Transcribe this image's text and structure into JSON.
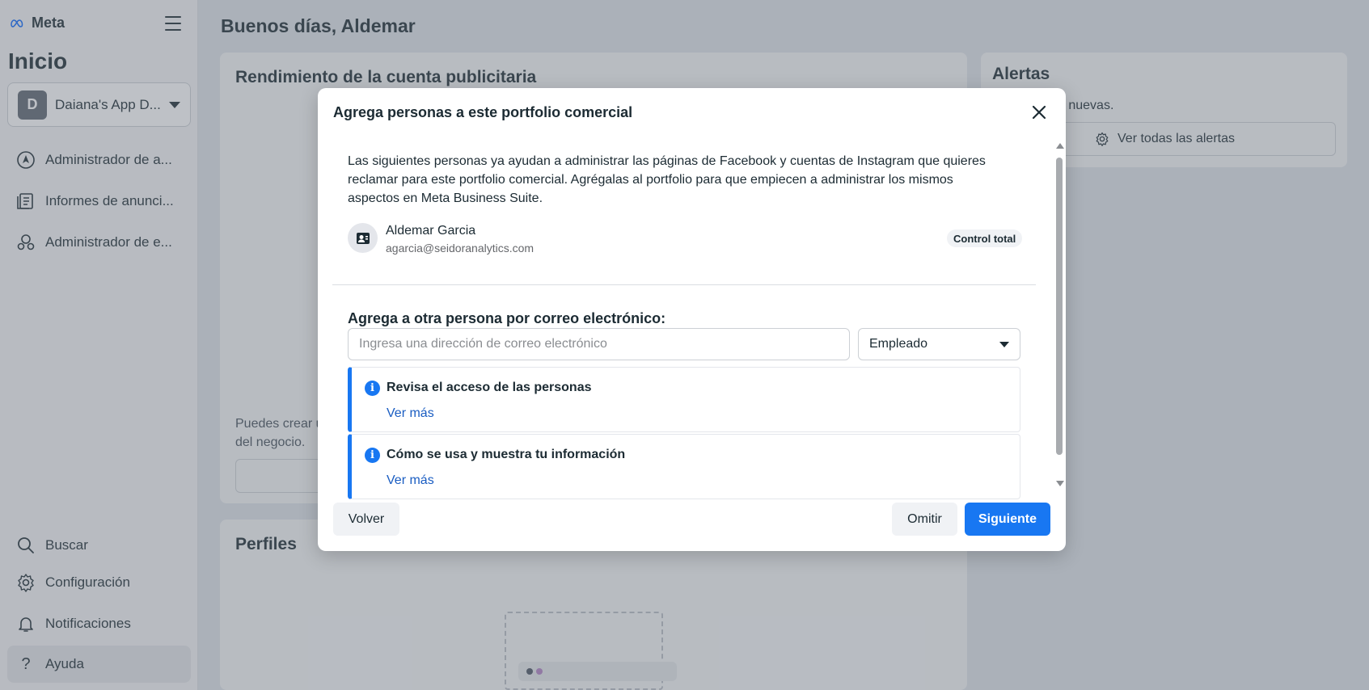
{
  "brand": {
    "name": "Meta"
  },
  "sidebar": {
    "title": "Inicio",
    "account": {
      "initial": "D",
      "name": "Daiana's App D..."
    },
    "nav_items": [
      {
        "label": "Administrador de a...",
        "icon": "navigation-icon"
      },
      {
        "label": "Informes de anunci...",
        "icon": "reports-icon"
      },
      {
        "label": "Administrador de e...",
        "icon": "events-icon"
      }
    ],
    "bottom_items": [
      {
        "label": "Buscar",
        "icon": "search-icon"
      },
      {
        "label": "Configuración",
        "icon": "gear-icon"
      },
      {
        "label": "Notificaciones",
        "icon": "bell-icon"
      },
      {
        "label": "Ayuda",
        "icon": "help-icon"
      }
    ]
  },
  "main": {
    "greeting": "Buenos días, Aldemar",
    "performance_card": {
      "title": "Rendimiento de la cuenta publicitaria",
      "text_line1": "Puedes crear u",
      "text_line2": "del negocio."
    },
    "profiles_card": {
      "title": "Perfiles"
    },
    "alerts_card": {
      "title": "Alertas",
      "text": "as nuevas.",
      "button_label": "Ver todas las alertas"
    }
  },
  "modal": {
    "title": "Agrega personas a este portfolio comercial",
    "intro": "Las siguientes personas ya ayudan a administrar las páginas de Facebook y cuentas de Instagram que quieres reclamar para este portfolio comercial. Agrégalas al portfolio para que empiecen a administrar los mismos aspectos en Meta Business Suite.",
    "person": {
      "name": "Aldemar Garcia",
      "email": "agarcia@seidoranalytics.com",
      "badge": "Control total"
    },
    "add_label": "Agrega a otra persona por correo electrónico:",
    "email_placeholder": "Ingresa una dirección de correo electrónico",
    "email_value": "",
    "role_selected": "Empleado",
    "info_boxes": [
      {
        "title": "Revisa el acceso de las personas",
        "link": "Ver más"
      },
      {
        "title": "Cómo se usa y muestra tu información",
        "link": "Ver más"
      }
    ],
    "buttons": {
      "back": "Volver",
      "skip": "Omitir",
      "next": "Siguiente"
    }
  },
  "colors": {
    "primary": "#1877f2",
    "link": "#1a5dc2",
    "text": "#1c2b33"
  }
}
